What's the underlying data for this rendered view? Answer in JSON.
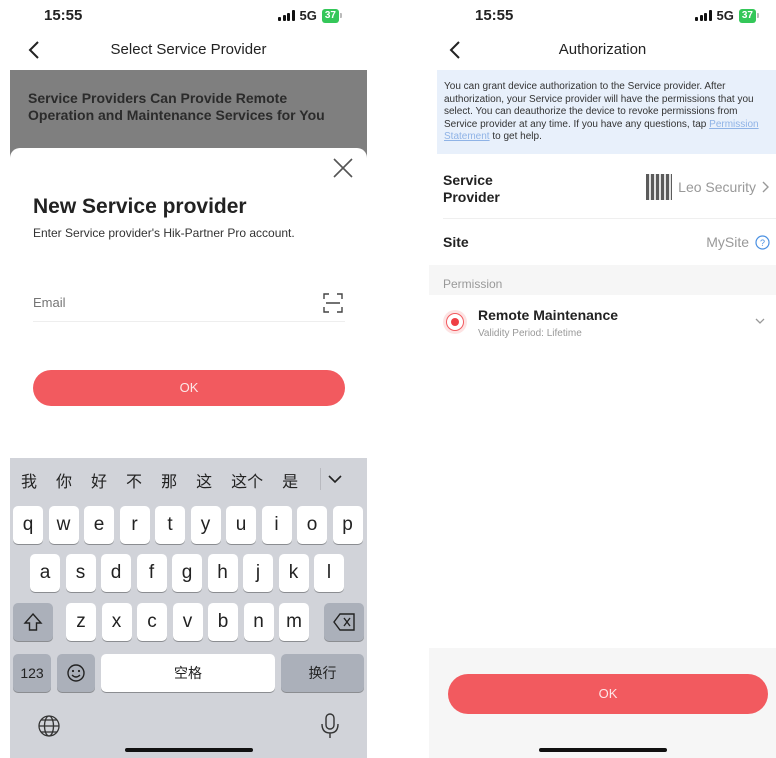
{
  "left": {
    "status": {
      "time": "15:55",
      "network": "5G",
      "battery": "37"
    },
    "nav_title": "Select Service Provider",
    "banner_text": "Service Providers Can Provide Remote Operation and Maintenance Services for You",
    "sheet": {
      "title": "New Service provider",
      "subtitle": "Enter Service provider's Hik-Partner Pro account.",
      "email_placeholder": "Email",
      "ok_label": "OK"
    },
    "keyboard": {
      "candidates": [
        "我",
        "你",
        "好",
        "不",
        "那",
        "这",
        "这个",
        "是"
      ],
      "row1": [
        "q",
        "w",
        "e",
        "r",
        "t",
        "y",
        "u",
        "i",
        "o",
        "p"
      ],
      "row2": [
        "a",
        "s",
        "d",
        "f",
        "g",
        "h",
        "j",
        "k",
        "l"
      ],
      "row3": [
        "z",
        "x",
        "c",
        "v",
        "b",
        "n",
        "m"
      ],
      "num_label": "123",
      "space_label": "空格",
      "return_label": "换行"
    }
  },
  "right": {
    "status": {
      "time": "15:55",
      "network": "5G",
      "battery": "37"
    },
    "nav_title": "Authorization",
    "info": {
      "text_before": "You can grant device authorization to the Service provider. After authorization, your Service provider will have the permissions that you select. You can deauthorize the device to revoke permissions from Service provider at any time. If you have any questions, tap ",
      "link": "Permission Statement",
      "text_after": " to get help."
    },
    "service_provider": {
      "label": "Service Provider",
      "value": "Leo Security"
    },
    "site": {
      "label": "Site",
      "value": "MySite"
    },
    "permission_header": "Permission",
    "permission": {
      "title": "Remote Maintenance",
      "validity": "Validity Period:  Lifetime"
    },
    "ok_label": "OK"
  },
  "colors": {
    "accent": "#f25a5f",
    "info_bg": "#e8f0fb",
    "keyboard_bg": "#d1d3d9",
    "battery": "#34c759"
  }
}
